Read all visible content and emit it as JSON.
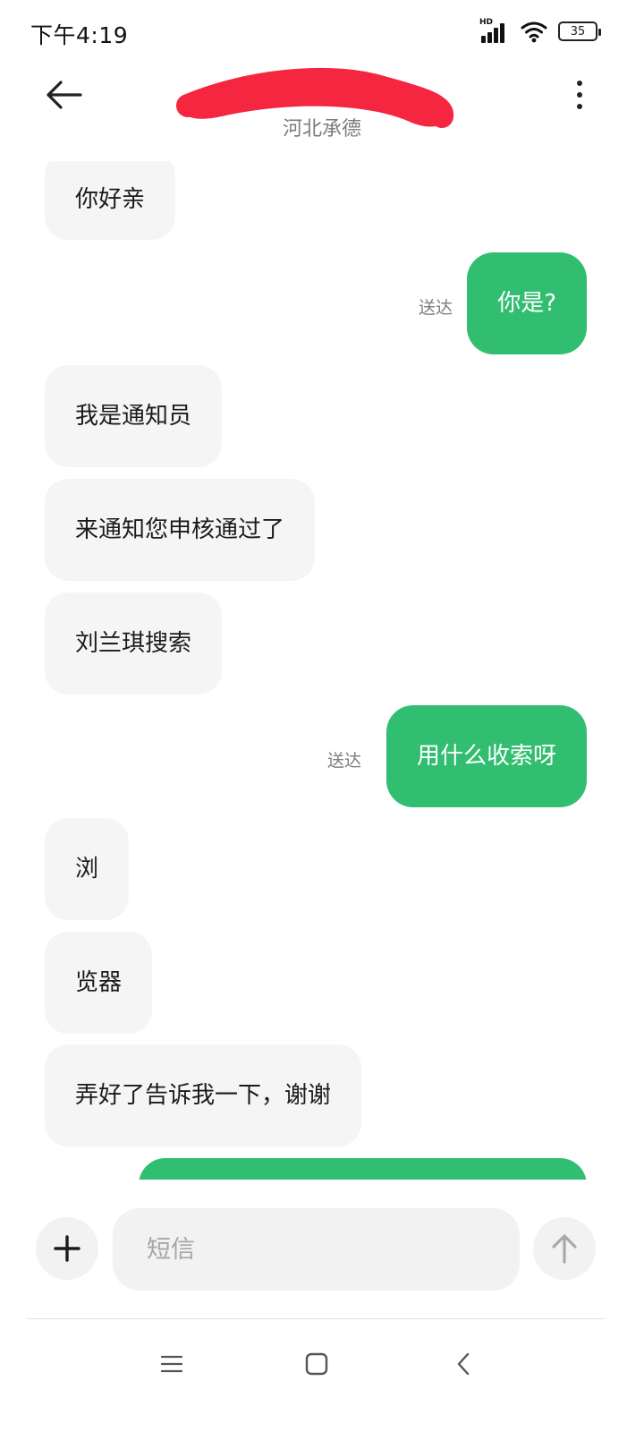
{
  "status_bar": {
    "time": "下午4:19",
    "network_badge": "HD",
    "battery_level": "35"
  },
  "header": {
    "contact_location": "河北承德"
  },
  "messages": [
    {
      "direction": "in",
      "text": "你好亲"
    },
    {
      "direction": "out",
      "text": "你是?",
      "status": "送达"
    },
    {
      "direction": "in",
      "text": "我是通知员"
    },
    {
      "direction": "in",
      "text": "来通知您申核通过了"
    },
    {
      "direction": "in",
      "text": "刘兰琪搜索"
    },
    {
      "direction": "out",
      "text": "用什么收索呀",
      "status": "送达"
    },
    {
      "direction": "in",
      "text": "浏"
    },
    {
      "direction": "in",
      "text": "览器"
    },
    {
      "direction": "in",
      "text": "弄好了告诉我一下，谢谢"
    },
    {
      "direction": "out",
      "text": ""
    }
  ],
  "input": {
    "placeholder": "短信"
  },
  "colors": {
    "outgoing_bubble": "#31be70",
    "incoming_bubble": "#f5f5f5",
    "redaction_mark": "#f5263f"
  },
  "icons": {
    "back": "arrow-left-icon",
    "more": "more-vertical-icon",
    "add": "plus-icon",
    "send": "arrow-up-icon",
    "nav_menu": "menu-icon",
    "nav_home": "home-square-icon",
    "nav_back": "chevron-left-icon"
  }
}
